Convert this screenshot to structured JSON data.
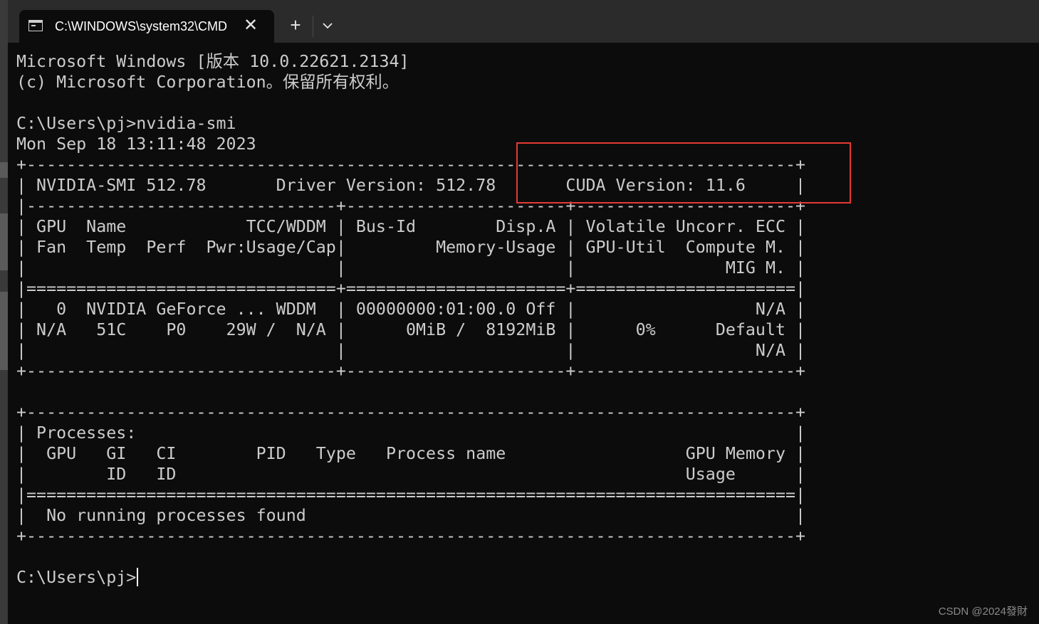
{
  "window": {
    "tab_title": "C:\\WINDOWS\\system32\\CMD",
    "close_glyph": "✕",
    "new_tab_glyph": "+",
    "icons": [
      "cmd-icon",
      "close-icon",
      "plus-icon",
      "chevron-down-icon"
    ]
  },
  "terminal": {
    "lines": [
      "Microsoft Windows [版本 10.0.22621.2134]",
      "(c) Microsoft Corporation。保留所有权利。",
      "",
      "C:\\Users\\pj>nvidia-smi",
      "Mon Sep 18 13:11:48 2023",
      "+-----------------------------------------------------------------------------+",
      "| NVIDIA-SMI 512.78       Driver Version: 512.78       CUDA Version: 11.6     |",
      "|-------------------------------+----------------------+----------------------+",
      "| GPU  Name            TCC/WDDM | Bus-Id        Disp.A | Volatile Uncorr. ECC |",
      "| Fan  Temp  Perf  Pwr:Usage/Cap|         Memory-Usage | GPU-Util  Compute M. |",
      "|                               |                      |               MIG M. |",
      "|===============================+======================+======================|",
      "|   0  NVIDIA GeForce ... WDDM  | 00000000:01:00.0 Off |                  N/A |",
      "| N/A   51C    P0    29W /  N/A |      0MiB /  8192MiB |      0%      Default |",
      "|                               |                      |                  N/A |",
      "+-------------------------------+----------------------+----------------------+",
      "",
      "+-----------------------------------------------------------------------------+",
      "| Processes:                                                                  |",
      "|  GPU   GI   CI        PID   Type   Process name                  GPU Memory |",
      "|        ID   ID                                                   Usage      |",
      "|=============================================================================|",
      "|  No running processes found                                                 |",
      "+-----------------------------------------------------------------------------+",
      ""
    ],
    "prompt": "C:\\Users\\pj>"
  },
  "colors": {
    "terminal_bg": "#0c0c0c",
    "terminal_fg": "#cccccc",
    "titlebar_bg": "#2b2b2b",
    "highlight": "#e53935"
  },
  "watermark": "CSDN @2024發財"
}
